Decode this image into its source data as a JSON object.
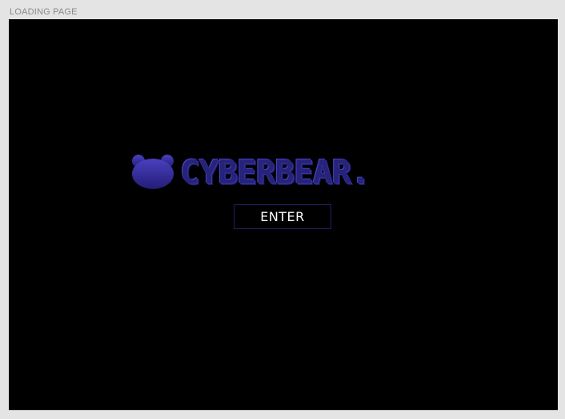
{
  "frame": {
    "label": "LOADING PAGE"
  },
  "logo": {
    "icon": "bear-head-icon",
    "text": "CYBERBEAR.",
    "colors": {
      "primary": "#26237a",
      "highlight": "#4a44c8",
      "bear_top": "#4a40c0",
      "bear_bottom": "#241d75"
    }
  },
  "enter_button": {
    "label": "ENTER",
    "border_color": "#23206a"
  }
}
